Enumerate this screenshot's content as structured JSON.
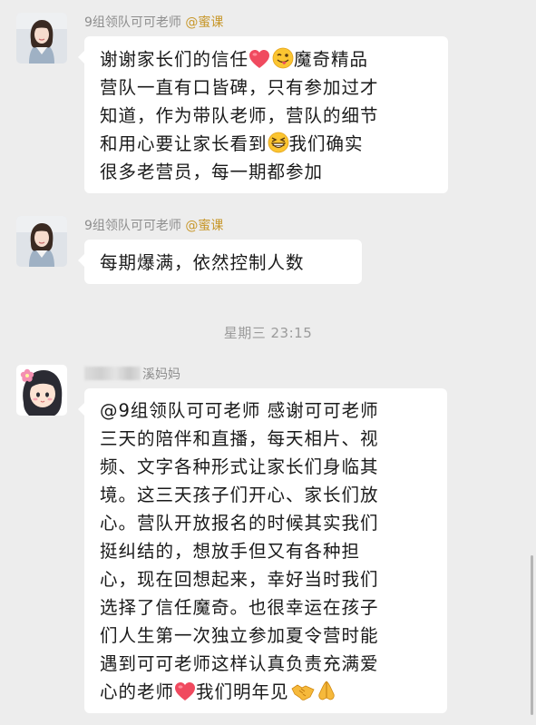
{
  "messages": [
    {
      "sender_name": "9组领队可可老师",
      "sender_tag": "@蜜课",
      "lines": [
        "谢谢家长们的信任",
        "魔奇精品",
        "营队一直有口皆碑，只有参加过才",
        "知道，作为带队老师，营队的细节",
        "和用心要让家长看到",
        "我们确实",
        "很多老营员，每一期都参加"
      ]
    },
    {
      "sender_name": "9组领队可可老师",
      "sender_tag": "@蜜课",
      "lines": [
        "每期爆满，依然控制人数"
      ]
    },
    {
      "sender_name": "溪妈妈",
      "lines": [
        "@9组领队可可老师 感谢可可老师",
        "三天的陪伴和直播，每天相片、视",
        "频、文字各种形式让家长们身临其",
        "境。这三天孩子们开心、家长们放",
        "心。营队开放报名的时候其实我们",
        "挺纠结的，想放手但又有各种担",
        "心，现在回想起来，幸好当时我们",
        "选择了信任魔奇。也很幸运在孩子",
        "们人生第一次独立参加夏令营时能",
        "遇到可可老师这样认真负责充满爱",
        "心的老师",
        "我们明年见"
      ]
    }
  ],
  "timestamp": "星期三 23:15",
  "icons": {
    "heart": "red-heart-emoji-icon",
    "wink": "winking-tongue-emoji-icon",
    "grin": "grinning-squinting-emoji-icon",
    "handshake": "handshake-emoji-icon",
    "pray": "folded-hands-emoji-icon"
  },
  "colors": {
    "background": "#ededed",
    "bubble": "#ffffff",
    "sender_name": "#8e8e8e",
    "sender_tag": "#c7972a",
    "heart": "#f04a5f"
  }
}
